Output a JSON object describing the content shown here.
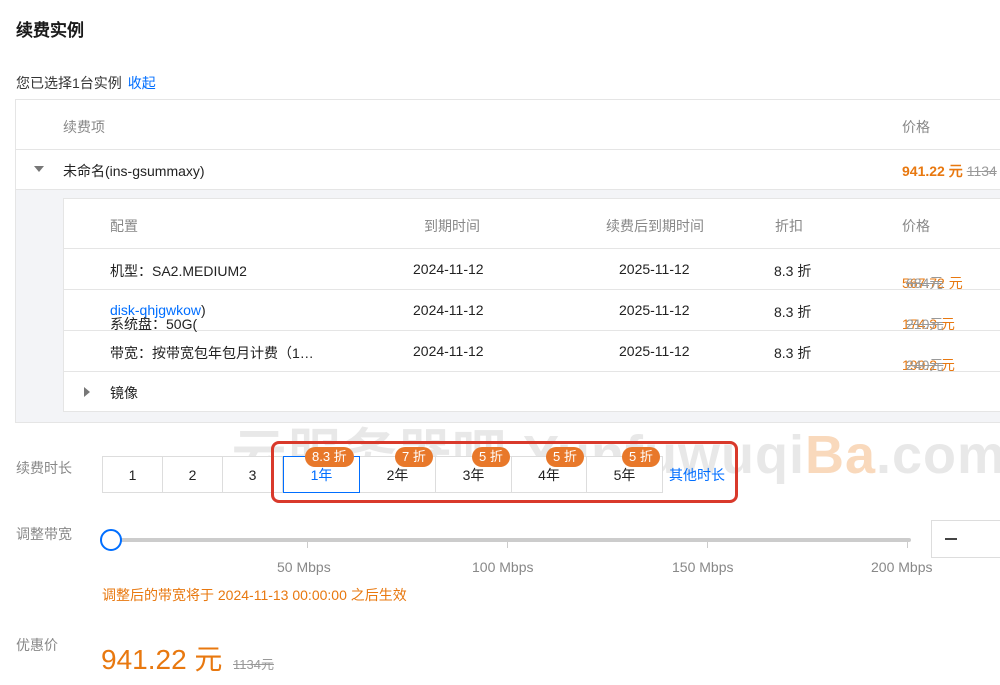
{
  "page": {
    "title": "续费实例",
    "selected_text": "您已选择1台实例",
    "collapse_link": "收起"
  },
  "main_table": {
    "headers": {
      "item": "续费项",
      "price": "价格"
    },
    "instance": {
      "name": "未命名(ins-gsummaxy)",
      "price": "941.22 元",
      "old_price": "1134"
    }
  },
  "sub_table": {
    "headers": {
      "config": "配置",
      "expire": "到期时间",
      "renew_expire": "续费后到期时间",
      "discount": "折扣",
      "price": "价格"
    },
    "rows": [
      {
        "config": "机型：SA2.MEDIUM2",
        "expire": "2024-11-12",
        "renew_expire": "2025-11-12",
        "discount": "8.3 折",
        "price": "567.72 元",
        "old_price": "684元"
      },
      {
        "config_prefix": "系统盘：50G(",
        "config_link": "disk-qhjgwkow",
        "config_suffix": ")",
        "expire": "2024-11-12",
        "renew_expire": "2025-11-12",
        "discount": "8.3 折",
        "price": "174.3 元",
        "old_price": "210元"
      },
      {
        "config": "带宽：按带宽包年包月计费（1…",
        "expire": "2024-11-12",
        "renew_expire": "2025-11-12",
        "discount": "8.3 折",
        "price": "199.2 元",
        "old_price": "240元"
      }
    ],
    "image_row": "镜像"
  },
  "watermark": {
    "main": "云服务器吧 Yunfuwuqi",
    "highlight": "Ba",
    "tail": ".com"
  },
  "duration": {
    "label": "续费时长",
    "months": [
      "1",
      "2",
      "3"
    ],
    "years": [
      "1年",
      "2年",
      "3年",
      "4年",
      "5年"
    ],
    "badges": [
      "8.3 折",
      "7 折",
      "5 折",
      "5 折",
      "5 折"
    ],
    "selected": "1年",
    "other_link": "其他时长"
  },
  "bandwidth": {
    "label": "调整带宽",
    "ticks": [
      "50 Mbps",
      "100 Mbps",
      "150 Mbps",
      "200 Mbps"
    ],
    "notice": "调整后的带宽将于 2024-11-13 00:00:00 之后生效",
    "minus_icon": "minus-icon"
  },
  "discount_price": {
    "label": "优惠价",
    "price": "941.22 元",
    "old_price": "1134元"
  },
  "colors": {
    "accent": "#006eff",
    "orange": "#e8780f",
    "badge": "#e8782a",
    "highlight_box": "#d9392b"
  }
}
